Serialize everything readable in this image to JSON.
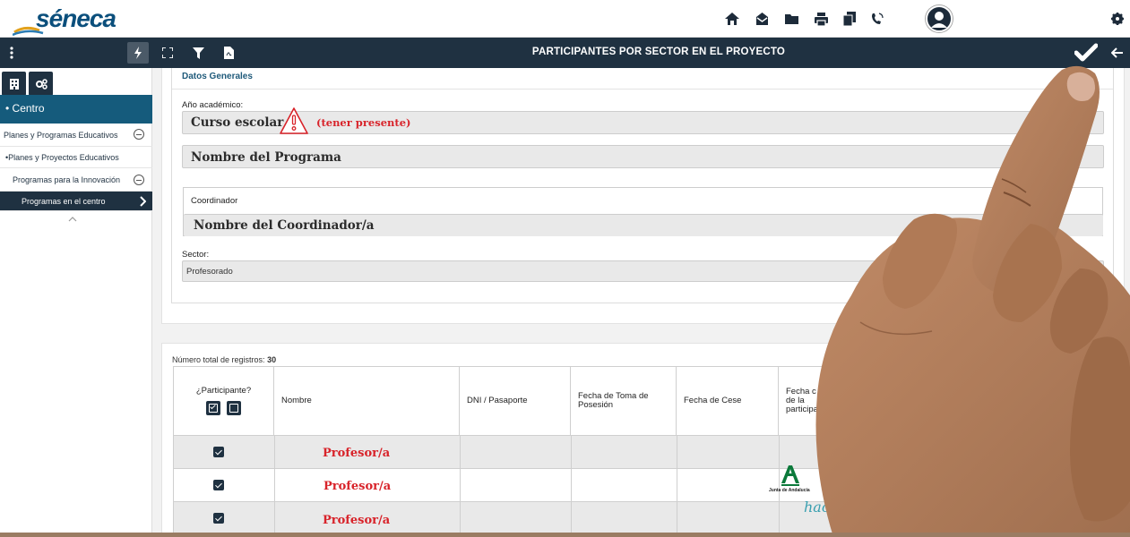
{
  "app": {
    "logo_text": "séneca",
    "page_title": "PARTICIPANTES POR SECTOR EN EL PROYECTO"
  },
  "topbar": {
    "icons": [
      "home-icon",
      "inbox-icon",
      "folder-icon",
      "print-icon",
      "documents-icon",
      "phone-icon",
      "user-avatar",
      "gear-icon"
    ]
  },
  "titlebar": {
    "icons": [
      "menu-dots-icon",
      "bolt-icon",
      "expand-icon",
      "filter-icon",
      "pdf-icon",
      "check-icon",
      "back-arrow-icon"
    ]
  },
  "sidebar": {
    "tabs": [
      "building-icon",
      "gears-icon"
    ],
    "centro": "• Centro",
    "items": [
      {
        "label": "Planes y Programas Educativos"
      },
      {
        "label": "•Planes y Proyectos Educativos"
      },
      {
        "label": "Programas para la Innovación"
      },
      {
        "label": "Programas en el centro"
      }
    ]
  },
  "form": {
    "section_title": "Datos Generales",
    "anio_label": "Año académico:",
    "anio_value": "Curso escolar",
    "anio_note": "(tener presente)",
    "programa_value": "Nombre del Programa",
    "coordinador_label": "Coordinador",
    "coordinador_value": "Nombre del Coordinador/a",
    "sector_label": "Sector:",
    "sector_value": "Profesorado"
  },
  "table": {
    "records_label": "Número total de registros:",
    "records_count": "30",
    "headers": {
      "participante": "¿Participante?",
      "nombre": "Nombre",
      "dni": "DNI / Pasaporte",
      "toma": "Fecha de Toma de Posesión",
      "cese": "Fecha de Cese",
      "fecha_part": "Fecha c de la participa"
    },
    "rows": [
      {
        "nombre": "Profesor/a",
        "checked": true
      },
      {
        "nombre": "Profesor/a",
        "checked": true
      },
      {
        "nombre": "Profesor/a",
        "checked": true
      }
    ]
  },
  "overlay": {
    "junta_text": "Junta de Andalucía",
    "hacer_text": "hacer"
  },
  "colors": {
    "header_dark": "#1f3141",
    "sidebar_active": "#155b7c",
    "accent_red": "#d8232a",
    "skin": "#b07a56"
  }
}
